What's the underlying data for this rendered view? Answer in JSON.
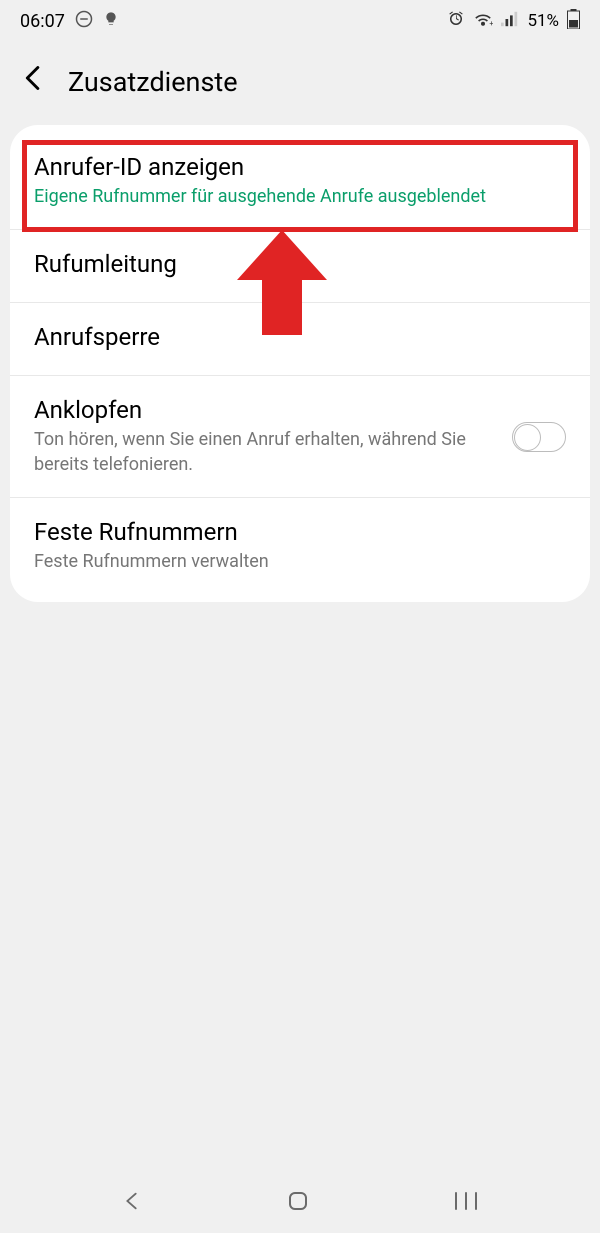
{
  "status": {
    "time": "06:07",
    "battery": "51%"
  },
  "header": {
    "title": "Zusatzdienste"
  },
  "rows": {
    "callerId": {
      "title": "Anrufer-ID anzeigen",
      "sub": "Eigene Rufnummer für ausgehende Anrufe ausgeblendet"
    },
    "forwarding": {
      "title": "Rufumleitung"
    },
    "barring": {
      "title": "Anrufsperre"
    },
    "waiting": {
      "title": "Anklopfen",
      "sub": "Ton hören, wenn Sie einen Anruf erhalten, während Sie bereits telefonieren."
    },
    "fixed": {
      "title": "Feste Rufnummern",
      "sub": "Feste Rufnummern verwalten"
    }
  }
}
